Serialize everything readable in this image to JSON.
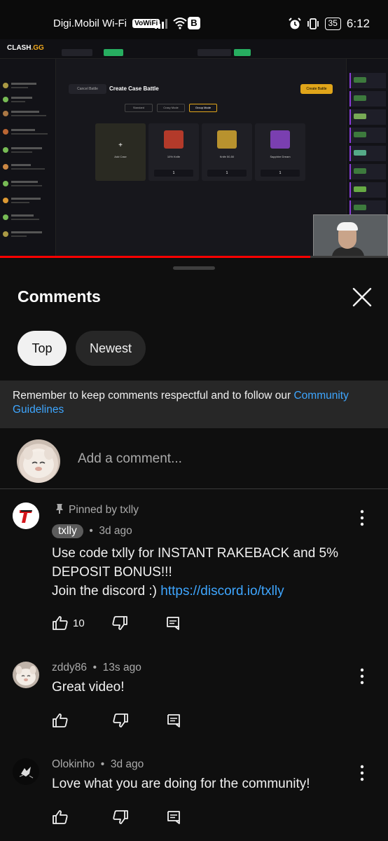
{
  "status_bar": {
    "carrier": "Digi.Mobil Wi-Fi",
    "vowifi_badge": "VoWiFi",
    "b_badge": "B",
    "battery": "35",
    "time": "6:12"
  },
  "video": {
    "site_logo_prefix": "CLASH",
    "site_logo_suffix": ".GG",
    "page_title": "Create Case Battle",
    "back_button": "Cancel Battle",
    "create_button": "Create Battle",
    "mode_tabs": [
      "Standard",
      "Crazy Mode",
      "Group Mode"
    ],
    "cases": [
      {
        "name": "Add Case"
      },
      {
        "name": "10% Knife",
        "qty": "1"
      },
      {
        "name": "Knife 50-50",
        "qty": "1"
      },
      {
        "name": "Sapphire Dream",
        "qty": "1"
      }
    ],
    "progress_fraction": 0.8
  },
  "sheet": {
    "title": "Comments",
    "chips": {
      "top": "Top",
      "newest": "Newest"
    },
    "notice_text": "Remember to keep comments respectful and to follow our ",
    "notice_link": "Community Guidelines",
    "add_comment_placeholder": "Add a comment..."
  },
  "comments": [
    {
      "pinned_label": "Pinned by txlly",
      "author": "txlly",
      "time": "3d ago",
      "line1": "Use code txlly for INSTANT RAKEBACK and 5% DEPOSIT BONUS!!!",
      "line2_prefix": "Join the discord :) ",
      "link": "https://discord.io/txlly",
      "likes": "10"
    },
    {
      "author": "zddy86",
      "time": "13s ago",
      "text": "Great video!",
      "likes": ""
    },
    {
      "author": "Olokinho",
      "time": "3d ago",
      "text": "Love what you are doing for the community!",
      "likes": ""
    }
  ],
  "icons": [
    "pin-icon",
    "thumbs-up-icon",
    "thumbs-down-icon",
    "reply-icon",
    "more-vert-icon",
    "close-icon"
  ],
  "colors": {
    "link": "#3ea6ff",
    "accent_gold": "#e0a51a",
    "progress": "#ff0000"
  }
}
